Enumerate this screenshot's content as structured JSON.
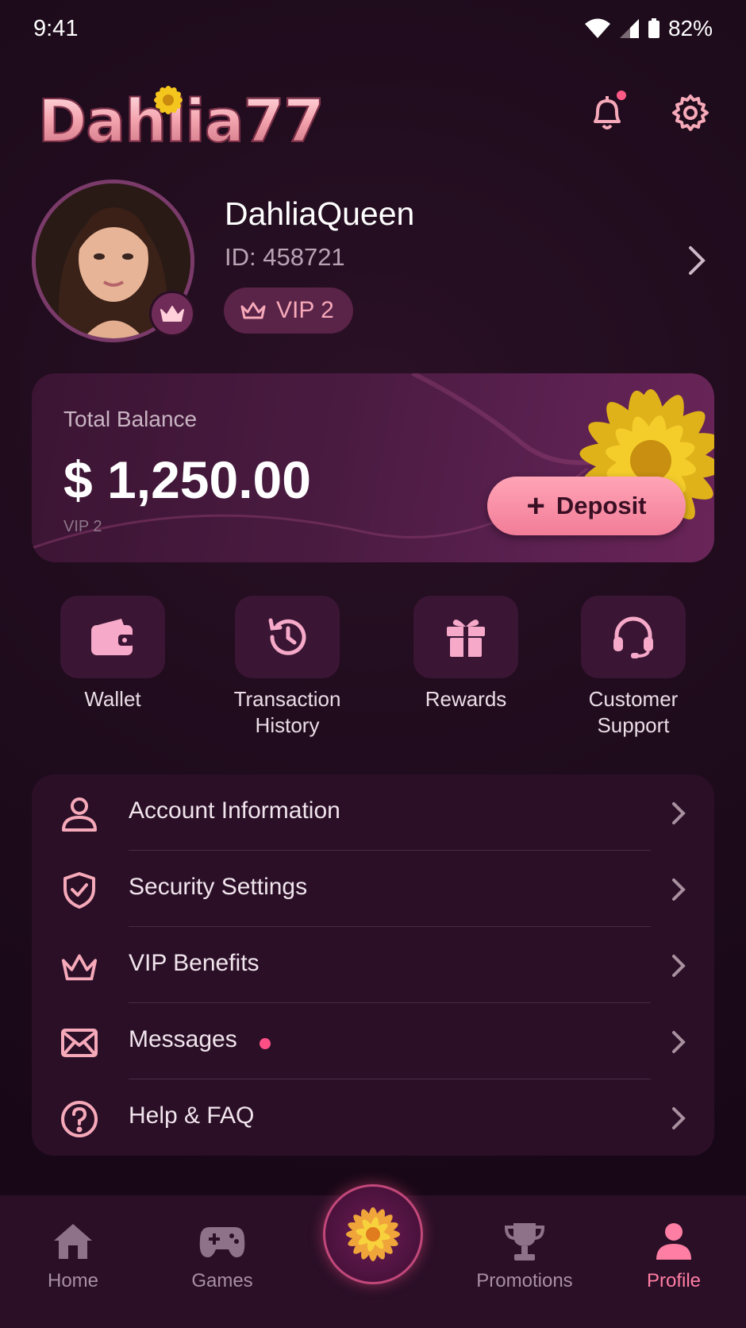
{
  "status_bar": {
    "time": "9:41",
    "battery": "82%"
  },
  "brand": {
    "name": "Dahlia77"
  },
  "profile": {
    "username": "DahliaQueen",
    "user_id": "ID: 458721",
    "vip_badge": "VIP 2"
  },
  "balance": {
    "label": "Total Balance",
    "amount": "$ 1,250.00",
    "sub_text": "VIP 2",
    "deposit_label": "Deposit"
  },
  "quick_actions": [
    {
      "label": "Wallet",
      "icon": "wallet-icon"
    },
    {
      "label": "Transaction\nHistory",
      "icon": "history-icon"
    },
    {
      "label": "Rewards",
      "icon": "gift-icon"
    },
    {
      "label": "Customer\nSupport",
      "icon": "headset-icon"
    }
  ],
  "menu": [
    {
      "label": "Account Information",
      "icon": "user-icon"
    },
    {
      "label": "Security Settings",
      "icon": "shield-check-icon"
    },
    {
      "label": "VIP Benefits",
      "icon": "crown-icon"
    },
    {
      "label": "Messages",
      "icon": "mail-icon",
      "unread": true
    },
    {
      "label": "Help & FAQ",
      "icon": "help-icon"
    }
  ],
  "bottom_nav": [
    {
      "label": "Home",
      "icon": "home-icon"
    },
    {
      "label": "Games",
      "icon": "gamepad-icon"
    },
    {
      "label": "",
      "icon": "dahlia-flower-icon"
    },
    {
      "label": "Promotions",
      "icon": "trophy-icon"
    },
    {
      "label": "Profile",
      "icon": "profile-icon",
      "active": true
    }
  ],
  "colors": {
    "accent_pink": "#f27d98",
    "background": "#1e0b1c",
    "card": "#2a0f27",
    "flower_yellow": "#f0c419",
    "active_nav": "#ff7ea3"
  }
}
